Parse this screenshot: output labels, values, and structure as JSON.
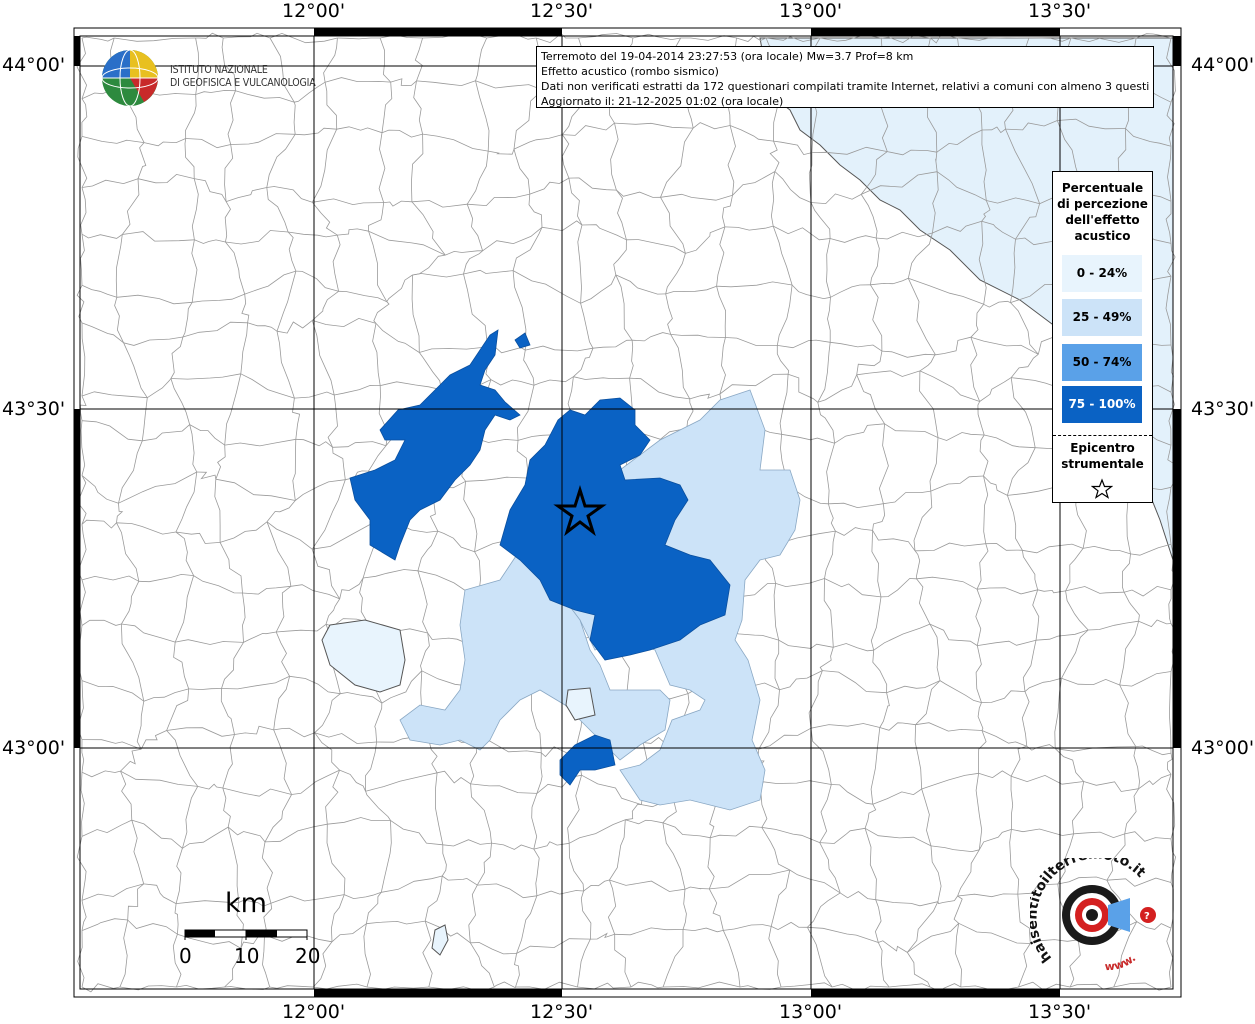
{
  "info": {
    "line1": "Terremoto del 19-04-2014 23:27:53 (ora locale) Mw=3.7 Prof=8 km",
    "line2": "Effetto acustico (rombo sismico)",
    "line3": "Dati non verificati estratti da 172 questionari compilati tramite Internet, relativi a comuni con almeno 3 questionari.",
    "line4": "Aggiornato il: 21-12-2025 01:02 (ora locale)"
  },
  "logo": {
    "line1": "ISTITUTO NAZIONALE",
    "line2": "DI GEOFISICA E VULCANOLOGIA"
  },
  "axes": {
    "lon_labels": [
      "12°00'",
      "12°30'",
      "13°00'",
      "13°30'"
    ],
    "lat_labels": [
      "44°00'",
      "43°30'",
      "43°00'"
    ]
  },
  "legend": {
    "title_lines": [
      "Percentuale",
      "di percezione",
      "dell'effetto",
      "acustico"
    ],
    "classes": [
      {
        "label": "0 - 24%",
        "color": "#e8f4fd"
      },
      {
        "label": "25 - 49%",
        "color": "#cce3f8"
      },
      {
        "label": "50 - 74%",
        "color": "#5aa1e8"
      },
      {
        "label": "75 - 100%",
        "color": "#0a62c4"
      }
    ],
    "epicenter_lines": [
      "Epicentro",
      "strumentale"
    ]
  },
  "scale": {
    "title": "km",
    "labels": [
      "0",
      "10",
      "20"
    ]
  },
  "colors": {
    "sea": "#e3f1fb",
    "class_0_24": "#e8f4fd",
    "class_25_49": "#cce3f8",
    "class_75_100": "#0a62c4"
  },
  "badge": {
    "text": "haisentitoilterremoto.it",
    "www": "www."
  }
}
